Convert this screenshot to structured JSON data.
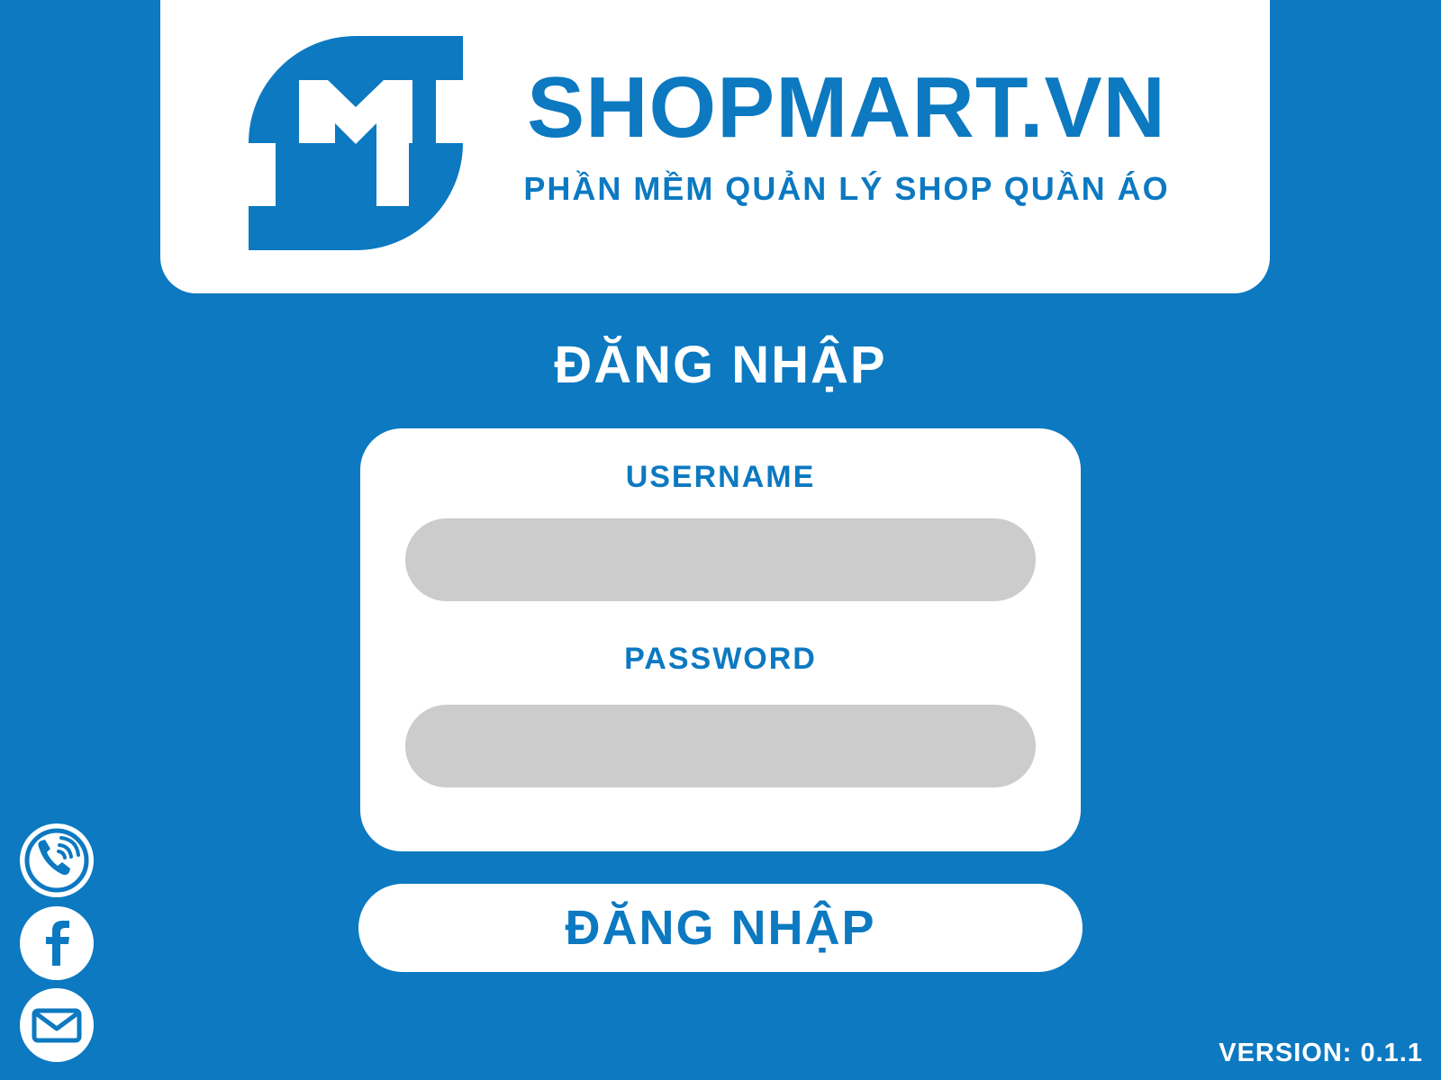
{
  "header": {
    "brand_name": "SHOPMART.VN",
    "tagline": "PHẦN MỀM QUẢN LÝ SHOP QUẦN ÁO",
    "logo_icon": "sm-monogram-logo"
  },
  "login": {
    "heading": "ĐĂNG NHẬP",
    "username_label": "USERNAME",
    "username_value": "",
    "password_label": "PASSWORD",
    "password_value": "",
    "submit_label": "ĐĂNG NHẬP"
  },
  "contacts": [
    {
      "icon": "phone-icon"
    },
    {
      "icon": "facebook-icon"
    },
    {
      "icon": "mail-icon"
    }
  ],
  "footer": {
    "version": "VERSION: 0.1.1"
  },
  "colors": {
    "primary": "#0c79c1",
    "card": "#ffffff",
    "input": "#cccccc"
  }
}
